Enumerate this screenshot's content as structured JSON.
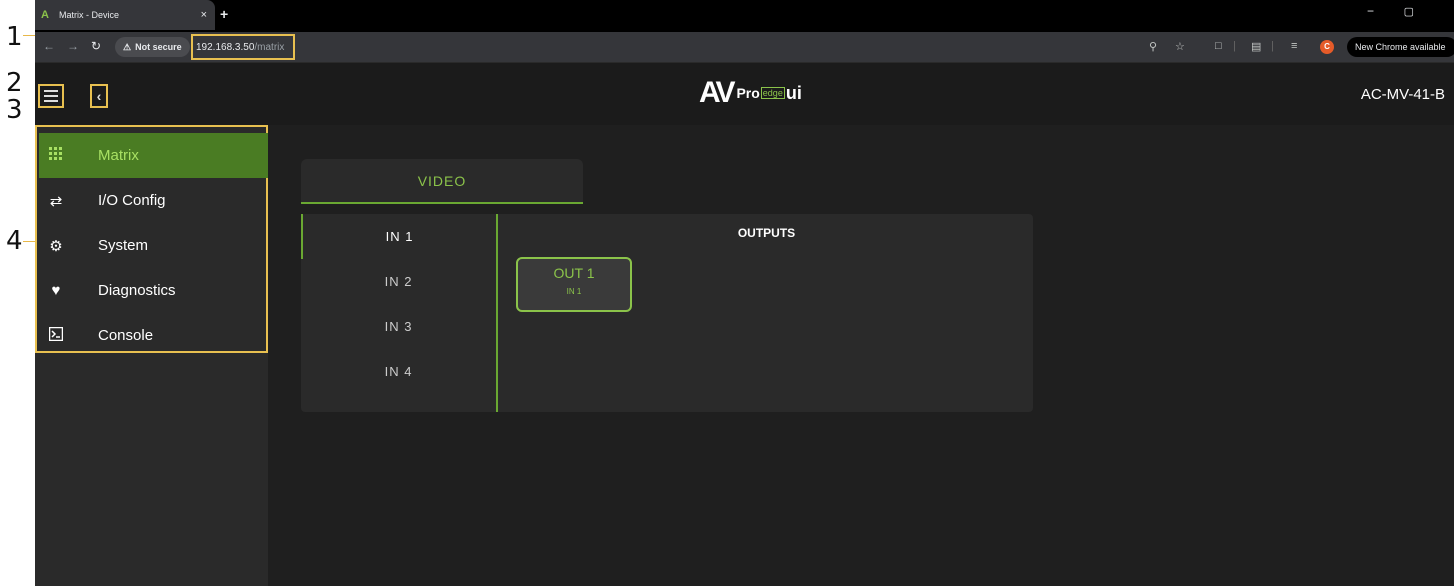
{
  "annotations": [
    "1",
    "2",
    "3",
    "4"
  ],
  "browser": {
    "tab_title": "Matrix - Device",
    "tab_favicon": "A",
    "tab_close": "×",
    "new_tab": "+",
    "window_min": "−",
    "window_restore": "▢",
    "security_label": "Not secure",
    "url_host": "192.168.3.50",
    "url_path": "/matrix",
    "profile_initial": "C",
    "update_label": "New Chrome available"
  },
  "app": {
    "logo_av": "AV",
    "logo_pro": "Pro",
    "logo_edge": "edge",
    "logo_ui": "ui",
    "device_name": "AC-MV-41-B"
  },
  "sidebar": {
    "items": [
      {
        "label": "Matrix",
        "icon": "grid-icon"
      },
      {
        "label": "I/O Config",
        "icon": "swap-arrows-icon"
      },
      {
        "label": "System",
        "icon": "gear-icon"
      },
      {
        "label": "Diagnostics",
        "icon": "heartbeat-icon"
      },
      {
        "label": "Console",
        "icon": "terminal-icon"
      }
    ]
  },
  "matrix": {
    "tab_label": "VIDEO",
    "inputs": [
      "IN 1",
      "IN 2",
      "IN 3",
      "IN 4"
    ],
    "outputs_title": "OUTPUTS",
    "outputs": [
      {
        "name": "OUT 1",
        "source": "IN 1"
      }
    ]
  },
  "colors": {
    "accent": "#8bc34a",
    "annotation": "#e8c050",
    "active_nav": "#4a7c23"
  }
}
